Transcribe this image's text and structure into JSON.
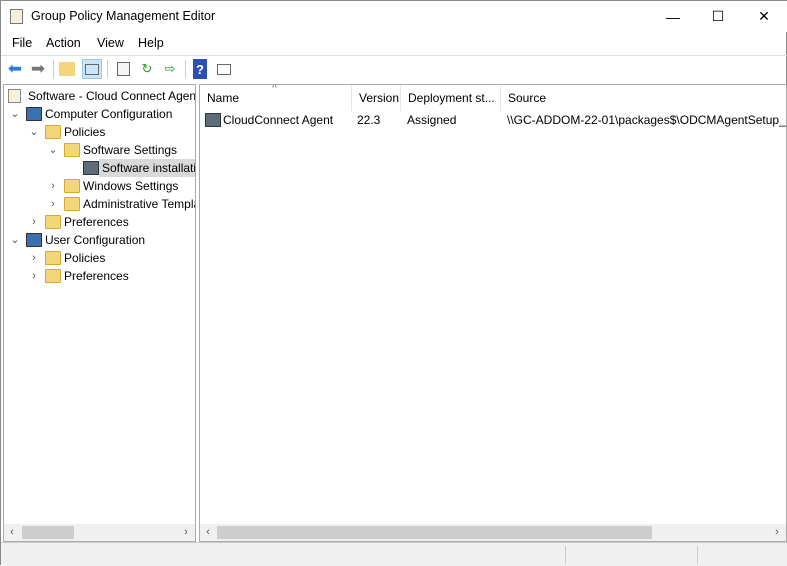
{
  "window": {
    "title": "Group Policy Management Editor",
    "minimize": "—",
    "maximize": "☐",
    "close": "✕"
  },
  "menu": [
    "File",
    "Action",
    "View",
    "Help"
  ],
  "toolbar": {
    "icons": [
      "back-icon",
      "forward-icon",
      "up-folder-icon",
      "show-hide-tree-icon",
      "properties-icon",
      "refresh-icon",
      "export-list-icon",
      "help-icon",
      "show-action-pane-icon"
    ]
  },
  "tree": {
    "root": "Software - Cloud Connect Agent",
    "items": [
      {
        "label": "Computer Configuration",
        "level": 1,
        "expanded": true
      },
      {
        "label": "Policies",
        "level": 2,
        "expanded": true
      },
      {
        "label": "Software Settings",
        "level": 3,
        "expanded": true
      },
      {
        "label": "Software installation",
        "level": 4,
        "selected": true
      },
      {
        "label": "Windows Settings",
        "level": 3,
        "expanded": false
      },
      {
        "label": "Administrative Templates",
        "level": 3,
        "expanded": false
      },
      {
        "label": "Preferences",
        "level": 2,
        "expanded": false
      },
      {
        "label": "User Configuration",
        "level": 1,
        "expanded": true
      },
      {
        "label": "Policies",
        "level": 2,
        "expanded": false
      },
      {
        "label": "Preferences",
        "level": 2,
        "expanded": false
      }
    ]
  },
  "list": {
    "columns": [
      "Name",
      "Version",
      "Deployment st...",
      "Source"
    ],
    "rows": [
      {
        "name": "CloudConnect Agent",
        "version": "22.3",
        "deployment": "Assigned",
        "source": "\\\\GC-ADDOM-22-01\\packages$\\ODCMAgentSetup_"
      }
    ]
  }
}
